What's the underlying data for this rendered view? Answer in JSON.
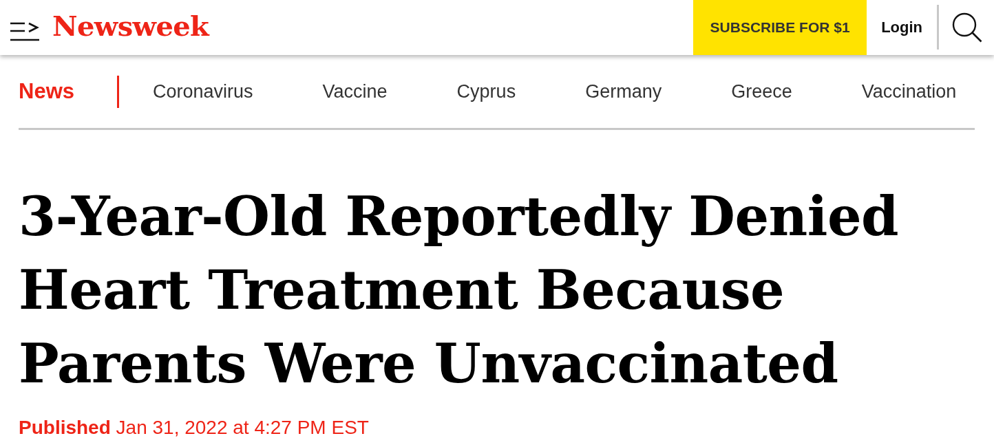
{
  "header": {
    "logo": "Newsweek",
    "subscribe_button": "SUBSCRIBE FOR $1",
    "login_link": "Login"
  },
  "nav": {
    "section": "News",
    "topics": [
      "Coronavirus",
      "Vaccine",
      "Cyprus",
      "Germany",
      "Greece",
      "Vaccination"
    ]
  },
  "article": {
    "headline": "3-Year-Old Reportedly Denied Heart Treatment Because Parents Were Unvaccinated",
    "published": "**Published** Jan 31, 2022 at 4:27 PM EST"
  }
}
